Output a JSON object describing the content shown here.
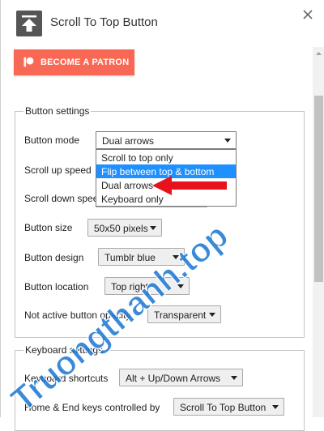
{
  "header": {
    "title": "Scroll To Top Button"
  },
  "patron": {
    "label": "BECOME A PATRON"
  },
  "button_settings": {
    "legend": "Button settings",
    "button_mode": {
      "label": "Button mode",
      "value": "Dual arrows",
      "options": [
        "Scroll to top only",
        "Flip between top & bottom",
        "Dual arrows",
        "Keyboard only"
      ]
    },
    "scroll_up_speed": {
      "label": "Scroll up speed"
    },
    "scroll_down_speed": {
      "label": "Scroll down spee"
    },
    "button_size": {
      "label": "Button size",
      "value": "50x50 pixels"
    },
    "button_design": {
      "label": "Button design",
      "value": "Tumblr blue"
    },
    "button_location": {
      "label": "Button location",
      "value": "Top right"
    },
    "opacity": {
      "label": "Not active button opacity",
      "value": "Transparent"
    }
  },
  "keyboard_settings": {
    "legend": "Keyboard settings",
    "shortcuts": {
      "label": "Keyboard shortcuts",
      "value": "Alt + Up/Down Arrows"
    },
    "home_end": {
      "label": "Home & End keys controlled by",
      "value": "Scroll To Top Button"
    }
  },
  "watermark": {
    "text": "Truongthanh.top"
  },
  "colors": {
    "patron": "#f96854",
    "highlight": "#1e90ff",
    "arrow": "#e8121c",
    "watermark": "#1976d2"
  }
}
